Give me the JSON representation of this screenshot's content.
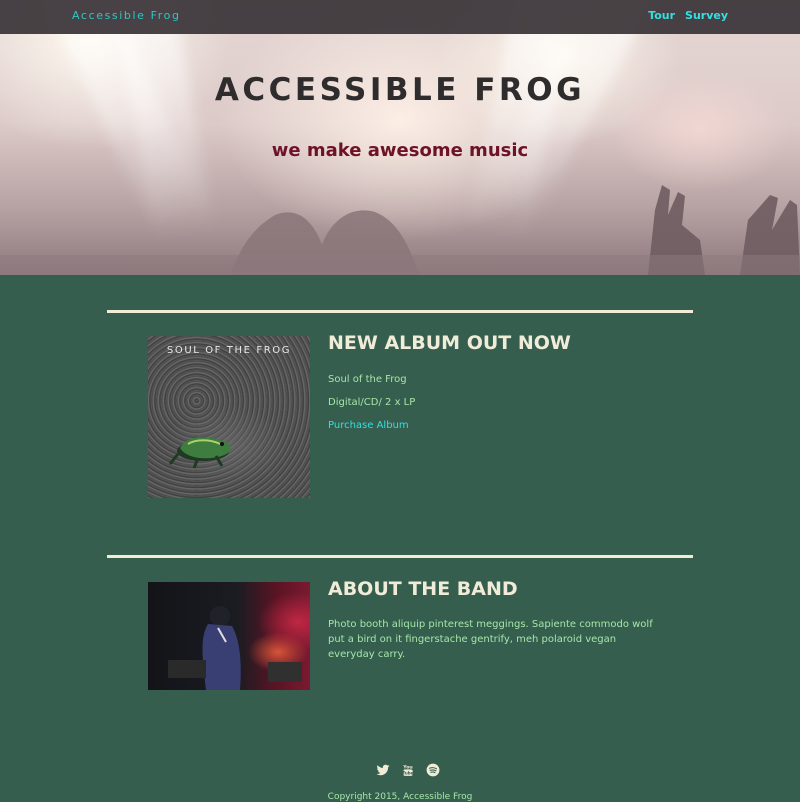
{
  "nav": {
    "brand": "Accessible Frog",
    "links": [
      {
        "label": "Tour"
      },
      {
        "label": "Survey"
      }
    ]
  },
  "hero": {
    "title": "ACCESSIBLE FROG",
    "subtitle": "we make awesome music"
  },
  "album": {
    "heading": "NEW ALBUM OUT NOW",
    "cover_text": "SOUL OF THE FROG",
    "name": "Soul of the Frog",
    "formats": "Digital/CD/ 2 x LP",
    "purchase_label": "Purchase Album"
  },
  "about": {
    "heading": "ABOUT THE BAND",
    "text": "Photo booth aliquip pinterest meggings. Sapiente commodo wolf put a bird on it fingerstache gentrify, meh polaroid vegan everyday carry."
  },
  "footer": {
    "social": [
      "twitter-icon",
      "youtube-icon",
      "spotify-icon"
    ],
    "copyright": "Copyright 2015, Accessible Frog"
  },
  "colors": {
    "background": "#355e4f",
    "accent": "#35dfe0",
    "heading": "#f1ecd8",
    "body_text": "#a6e6a8",
    "subtitle": "#6e1228"
  }
}
